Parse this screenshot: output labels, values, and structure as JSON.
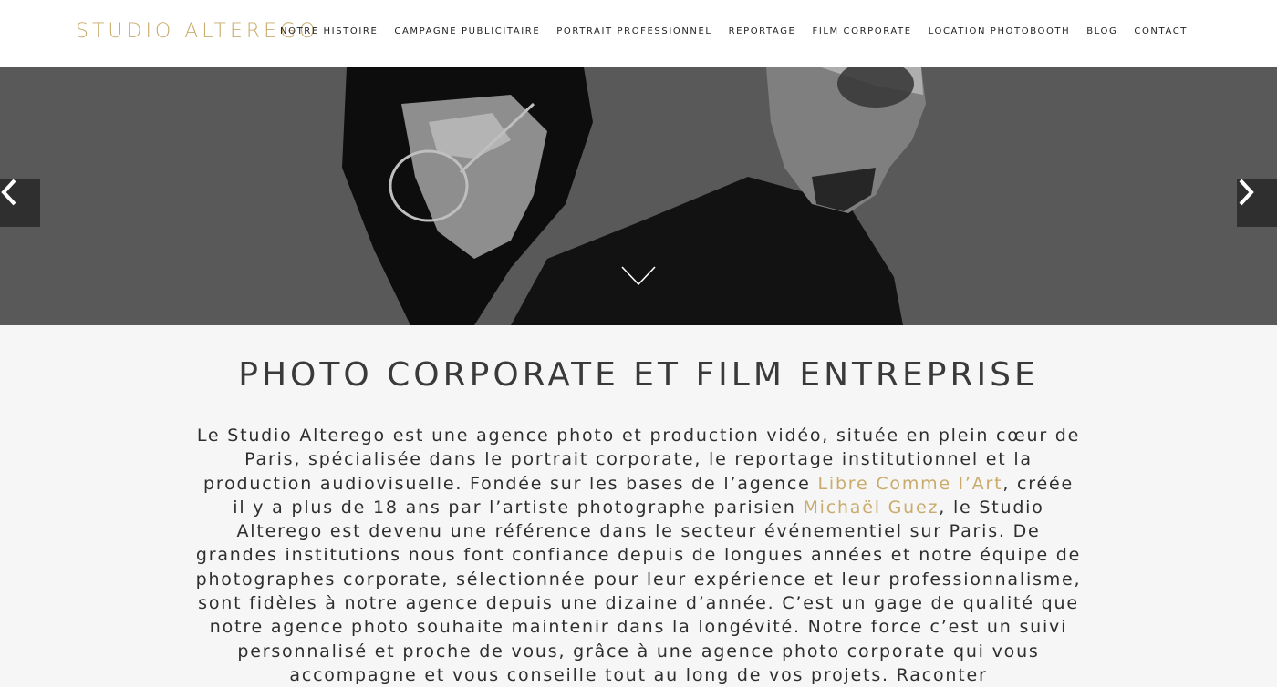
{
  "header": {
    "logo": "STUDIO ALTEREGO",
    "nav": [
      "NOTRE HISTOIRE",
      "CAMPAGNE PUBLICITAIRE",
      "PORTRAIT PROFESSIONNEL",
      "REPORTAGE",
      "FILM CORPORATE",
      "LOCATION PHOTOBOOTH",
      "BLOG",
      "CONTACT"
    ]
  },
  "hero": {
    "prev_icon": "chevron-left-icon",
    "next_icon": "chevron-right-icon",
    "scroll_icon": "chevron-down-icon"
  },
  "main": {
    "title": "PHOTO CORPORATE ET FILM ENTREPRISE",
    "intro_part1": "Le Studio Alterego est une agence photo et production vidéo, située en plein cœur de Paris, spécialisée dans le portrait corporate, le reportage institutionnel et la production audiovisuelle. Fondée sur les bases de l’agence ",
    "intro_link1": "Libre Comme l’Art",
    "intro_part2": ", créée il y a plus de 18 ans par l’artiste photographe parisien ",
    "intro_link2": "Michaël Guez",
    "intro_part3": ", le Studio Alterego est devenu une référence dans le secteur événementiel sur Paris. De grandes institutions nous font confiance depuis de longues années et notre équipe de photographes corporate, sélectionnée pour leur expérience et leur professionnalisme, sont fidèles à notre agence depuis une dizaine d’année. C’est un gage de qualité que notre agence photo souhaite maintenir dans la longévité. Notre force c’est un suivi personnalisé et proche de vous, grâce à une agence photo corporate qui vous accompagne et vous conseille tout au long de vos projets. Raconter"
  },
  "colors": {
    "accent": "#c9ab6b",
    "header_bg": "#ffffff",
    "page_bg": "#f6f6f6"
  }
}
